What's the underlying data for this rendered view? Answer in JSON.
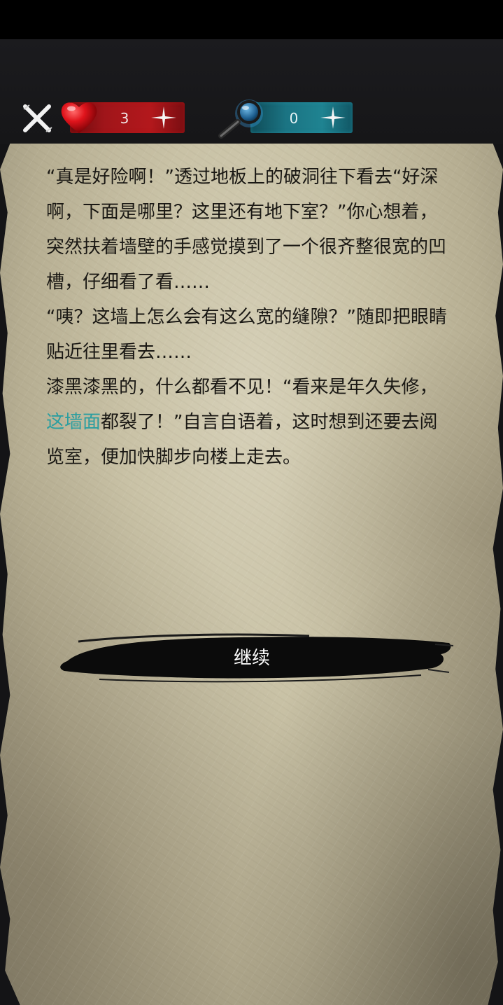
{
  "hud": {
    "lives": "3",
    "hints": "0"
  },
  "story": {
    "line1": "“真是好险啊！”透过地板上的破洞往下看去“好深啊，下面是哪里？这里还有地下室？”你心想着，突然扶着墙壁的手感觉摸到了一个很齐整很宽的凹槽，仔细看了看……",
    "line2": "“咦？这墙上怎么会有这么宽的缝隙？”随即把眼睛贴近往里看去……",
    "line3_before": "漆黑漆黑的，什么都看不见！“看来是年久失修，",
    "line3_highlight": "这墙面",
    "line3_after": "都裂了！”自言自语着，这时想到还要去阅览室，便加快脚步向楼上走去。"
  },
  "continue_label": "继续",
  "colors": {
    "highlight_text": "#2a9ea0",
    "life_bar": "#b3181c",
    "hint_bar": "#1f8391"
  },
  "icons": [
    "close-icon",
    "heart-icon",
    "plus-icon",
    "magnifier-icon"
  ]
}
